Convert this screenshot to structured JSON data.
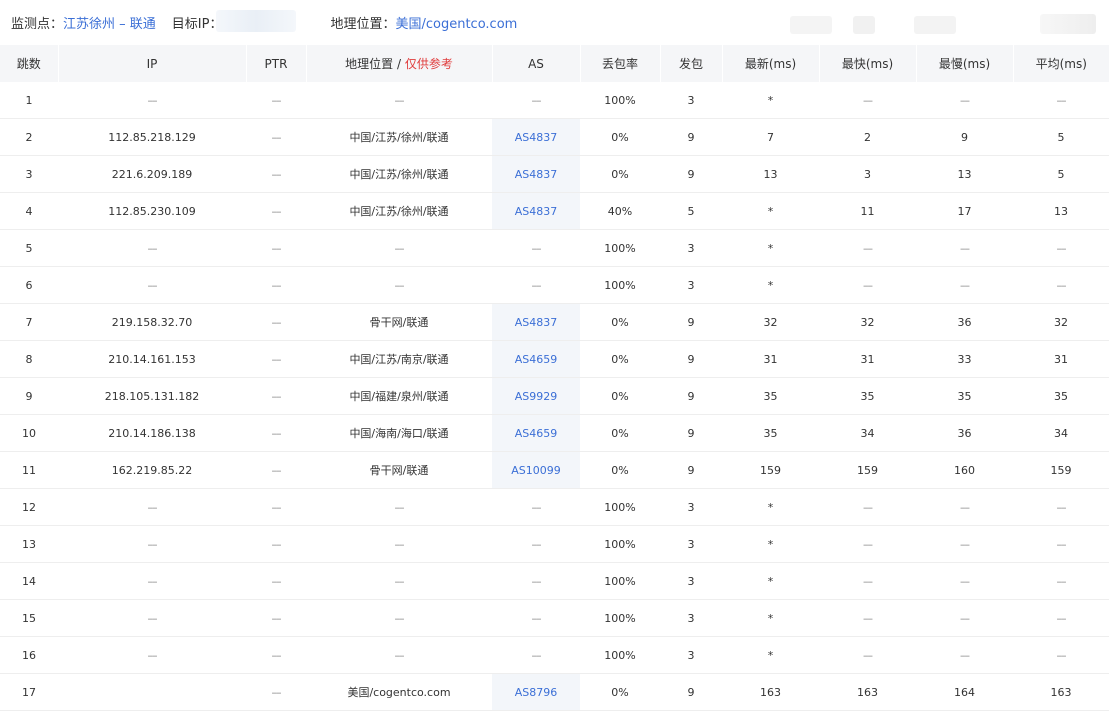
{
  "header": {
    "monitor_label": "监测点：",
    "monitor_value": "江苏徐州 – 联通",
    "target_label": "目标IP：",
    "geo_label": "地理位置：",
    "geo_value": "美国/cogentco.com"
  },
  "table": {
    "columns": {
      "hop": "跳数",
      "ip": "IP",
      "ptr": "PTR",
      "geo": "地理位置",
      "geo_sep": " / ",
      "geo_note": "仅供参考",
      "as": "AS",
      "loss": "丢包率",
      "sent": "发包",
      "last": "最新(ms)",
      "best": "最快(ms)",
      "worst": "最慢(ms)",
      "avg": "平均(ms)"
    },
    "rows": [
      {
        "hop": "1",
        "ip": "––",
        "ptr": "––",
        "geo": "––",
        "as": "––",
        "loss": "100%",
        "sent": "3",
        "last": "*",
        "best": "––",
        "worst": "––",
        "avg": "––"
      },
      {
        "hop": "2",
        "ip": "112.85.218.129",
        "ptr": "––",
        "geo": "中国/江苏/徐州/联通",
        "as": "AS4837",
        "loss": "0%",
        "sent": "9",
        "last": "7",
        "best": "2",
        "worst": "9",
        "avg": "5"
      },
      {
        "hop": "3",
        "ip": "221.6.209.189",
        "ptr": "––",
        "geo": "中国/江苏/徐州/联通",
        "as": "AS4837",
        "loss": "0%",
        "sent": "9",
        "last": "13",
        "best": "3",
        "worst": "13",
        "avg": "5"
      },
      {
        "hop": "4",
        "ip": "112.85.230.109",
        "ptr": "––",
        "geo": "中国/江苏/徐州/联通",
        "as": "AS4837",
        "loss": "40%",
        "sent": "5",
        "last": "*",
        "best": "11",
        "worst": "17",
        "avg": "13"
      },
      {
        "hop": "5",
        "ip": "––",
        "ptr": "––",
        "geo": "––",
        "as": "––",
        "loss": "100%",
        "sent": "3",
        "last": "*",
        "best": "––",
        "worst": "––",
        "avg": "––"
      },
      {
        "hop": "6",
        "ip": "––",
        "ptr": "––",
        "geo": "––",
        "as": "––",
        "loss": "100%",
        "sent": "3",
        "last": "*",
        "best": "––",
        "worst": "––",
        "avg": "––"
      },
      {
        "hop": "7",
        "ip": "219.158.32.70",
        "ptr": "––",
        "geo": "骨干网/联通",
        "as": "AS4837",
        "loss": "0%",
        "sent": "9",
        "last": "32",
        "best": "32",
        "worst": "36",
        "avg": "32"
      },
      {
        "hop": "8",
        "ip": "210.14.161.153",
        "ptr": "––",
        "geo": "中国/江苏/南京/联通",
        "as": "AS4659",
        "loss": "0%",
        "sent": "9",
        "last": "31",
        "best": "31",
        "worst": "33",
        "avg": "31"
      },
      {
        "hop": "9",
        "ip": "218.105.131.182",
        "ptr": "––",
        "geo": "中国/福建/泉州/联通",
        "as": "AS9929",
        "loss": "0%",
        "sent": "9",
        "last": "35",
        "best": "35",
        "worst": "35",
        "avg": "35"
      },
      {
        "hop": "10",
        "ip": "210.14.186.138",
        "ptr": "––",
        "geo": "中国/海南/海口/联通",
        "as": "AS4659",
        "loss": "0%",
        "sent": "9",
        "last": "35",
        "best": "34",
        "worst": "36",
        "avg": "34"
      },
      {
        "hop": "11",
        "ip": "162.219.85.22",
        "ptr": "––",
        "geo": "骨干网/联通",
        "as": "AS10099",
        "loss": "0%",
        "sent": "9",
        "last": "159",
        "best": "159",
        "worst": "160",
        "avg": "159"
      },
      {
        "hop": "12",
        "ip": "––",
        "ptr": "––",
        "geo": "––",
        "as": "––",
        "loss": "100%",
        "sent": "3",
        "last": "*",
        "best": "––",
        "worst": "––",
        "avg": "––"
      },
      {
        "hop": "13",
        "ip": "––",
        "ptr": "––",
        "geo": "––",
        "as": "––",
        "loss": "100%",
        "sent": "3",
        "last": "*",
        "best": "––",
        "worst": "––",
        "avg": "––"
      },
      {
        "hop": "14",
        "ip": "––",
        "ptr": "––",
        "geo": "––",
        "as": "––",
        "loss": "100%",
        "sent": "3",
        "last": "*",
        "best": "––",
        "worst": "––",
        "avg": "––"
      },
      {
        "hop": "15",
        "ip": "––",
        "ptr": "––",
        "geo": "––",
        "as": "––",
        "loss": "100%",
        "sent": "3",
        "last": "*",
        "best": "––",
        "worst": "––",
        "avg": "––"
      },
      {
        "hop": "16",
        "ip": "––",
        "ptr": "––",
        "geo": "––",
        "as": "––",
        "loss": "100%",
        "sent": "3",
        "last": "*",
        "best": "––",
        "worst": "––",
        "avg": "––"
      },
      {
        "hop": "17",
        "ip": "",
        "ptr": "––",
        "geo": "美国/cogentco.com",
        "as": "AS8796",
        "loss": "0%",
        "sent": "9",
        "last": "163",
        "best": "163",
        "worst": "164",
        "avg": "163"
      }
    ]
  },
  "colors": {
    "link": "#3b6fd6",
    "note": "#e03c3c",
    "header_bg": "#f5f6f8",
    "as_cell_bg": "#f3f6fa"
  }
}
